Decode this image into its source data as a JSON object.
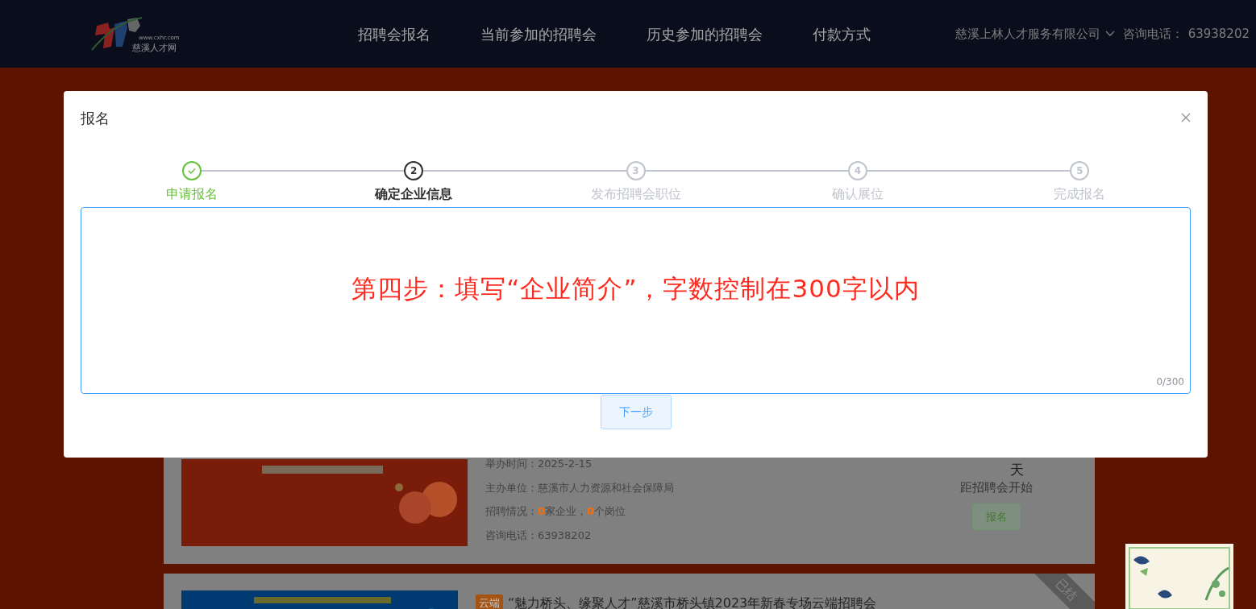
{
  "navbar": {
    "logo": {
      "url": "www.cxhr.com",
      "name": "慈溪人才网"
    },
    "links": [
      {
        "label": "招聘会报名"
      },
      {
        "label": "当前参加的招聘会"
      },
      {
        "label": "历史参加的招聘会"
      },
      {
        "label": "付款方式"
      }
    ],
    "company": "慈溪上林人才服务有限公司",
    "hotline_label": "咨询电话：",
    "hotline": "63938202"
  },
  "fairs": [
    {
      "image": {
        "kind": "picture"
      },
      "details": [
        {
          "label": "举办时间：",
          "value": "2025-2-15"
        },
        {
          "label": "主办单位：",
          "value": "慈溪市人力资源和社会保障局"
        },
        {
          "label": "招聘情况：",
          "value": "**0**家企业，**0**个岗位"
        },
        {
          "label": "咨询电话：",
          "value": "63938202"
        }
      ],
      "countdown_unit": "天",
      "countdown_caption": "距招聘会开始",
      "button": "报名"
    },
    {
      "image": {
        "kind": "picture"
      },
      "tag": "云端",
      "title": "“魅力桥头、缘聚人才”慈溪市桥头镇2023年新春专场云端招聘会",
      "ribbon": "已结"
    }
  ],
  "modal": {
    "title": "报名",
    "steps": [
      {
        "label": "申请报名",
        "completed": true,
        "selected": false
      },
      {
        "number": "2",
        "label": "确定企业信息",
        "completed": false,
        "selected": true
      },
      {
        "number": "3",
        "label": "发布招聘会职位",
        "completed": false,
        "selected": false
      },
      {
        "number": "4",
        "label": "确认展位",
        "completed": false,
        "selected": false
      },
      {
        "number": "5",
        "label": "完成报名",
        "completed": false,
        "selected": false
      }
    ],
    "textarea": {
      "annotation": "第四步：填写“企业简介”，字数控制在300字以内",
      "counter": "0/300"
    },
    "next_button": "下一步"
  },
  "corner_widget": {
    "kind": "picture"
  }
}
